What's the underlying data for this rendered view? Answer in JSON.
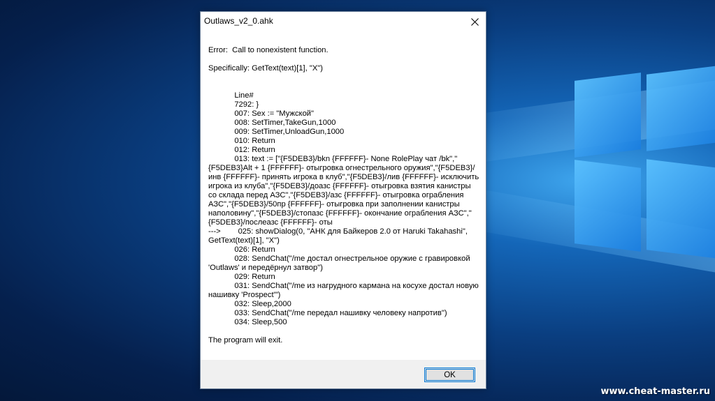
{
  "dialog": {
    "title": "Outlaws_v2_0.ahk",
    "error_line": "Error:  Call to nonexistent function.",
    "specifically_line": "Specifically: GetText(text)[1], \"X\")",
    "code_text": "            Line#\n            7292: }\n            007: Sex := \"Мужской\"\n            008: SetTimer,TakeGun,1000\n            009: SetTimer,UnloadGun,1000\n            010: Return\n            012: Return\n            013: text := [\"{F5DEB3}/bkn {FFFFFF}- None RolePlay чат /bk\",\"{F5DEB3}Alt + 1 {FFFFFF}- отыгровка огнестрельного оружия\",\"{F5DEB3}/инв {FFFFFF}- принять игрока в клуб\",\"{F5DEB3}/лив {FFFFFF}- исключить игрока из клуба\",\"{F5DEB3}/доазс {FFFFFF}- отыгровка взятия канистры со склада перед АЗС\",\"{F5DEB3}/азс {FFFFFF}- отыгровка ограбления АЗС\",\"{F5DEB3}/50пр {FFFFFF}- отыгровка при заполнении канистры наполовину\",\"{F5DEB3}/стопазс {FFFFFF}- окончание ограбления АЗС\",\"{F5DEB3}/послеазс {FFFFFF}- оты\n--->        025: showDialog(0, \"АНК для Байкеров 2.0 от Haruki Takahashi\", GetText(text)[1], \"X\")\n            026: Return\n            028: SendChat(\"/me достал огнестрельное оружие с гравировкой 'Outlaws' и передёрнул затвор\")\n            029: Return\n            031: SendChat(\"/me из нагрудного кармана на косухе достал новую нашивку 'Prospect'\")\n            032: Sleep,2000\n            033: SendChat(\"/me передал нашивку человеку напротив\")\n            034: Sleep,500",
    "exit_line": "The program will exit.",
    "ok_label": "OK",
    "close_icon": "close-icon"
  },
  "watermark": "www.cheat-master.ru"
}
